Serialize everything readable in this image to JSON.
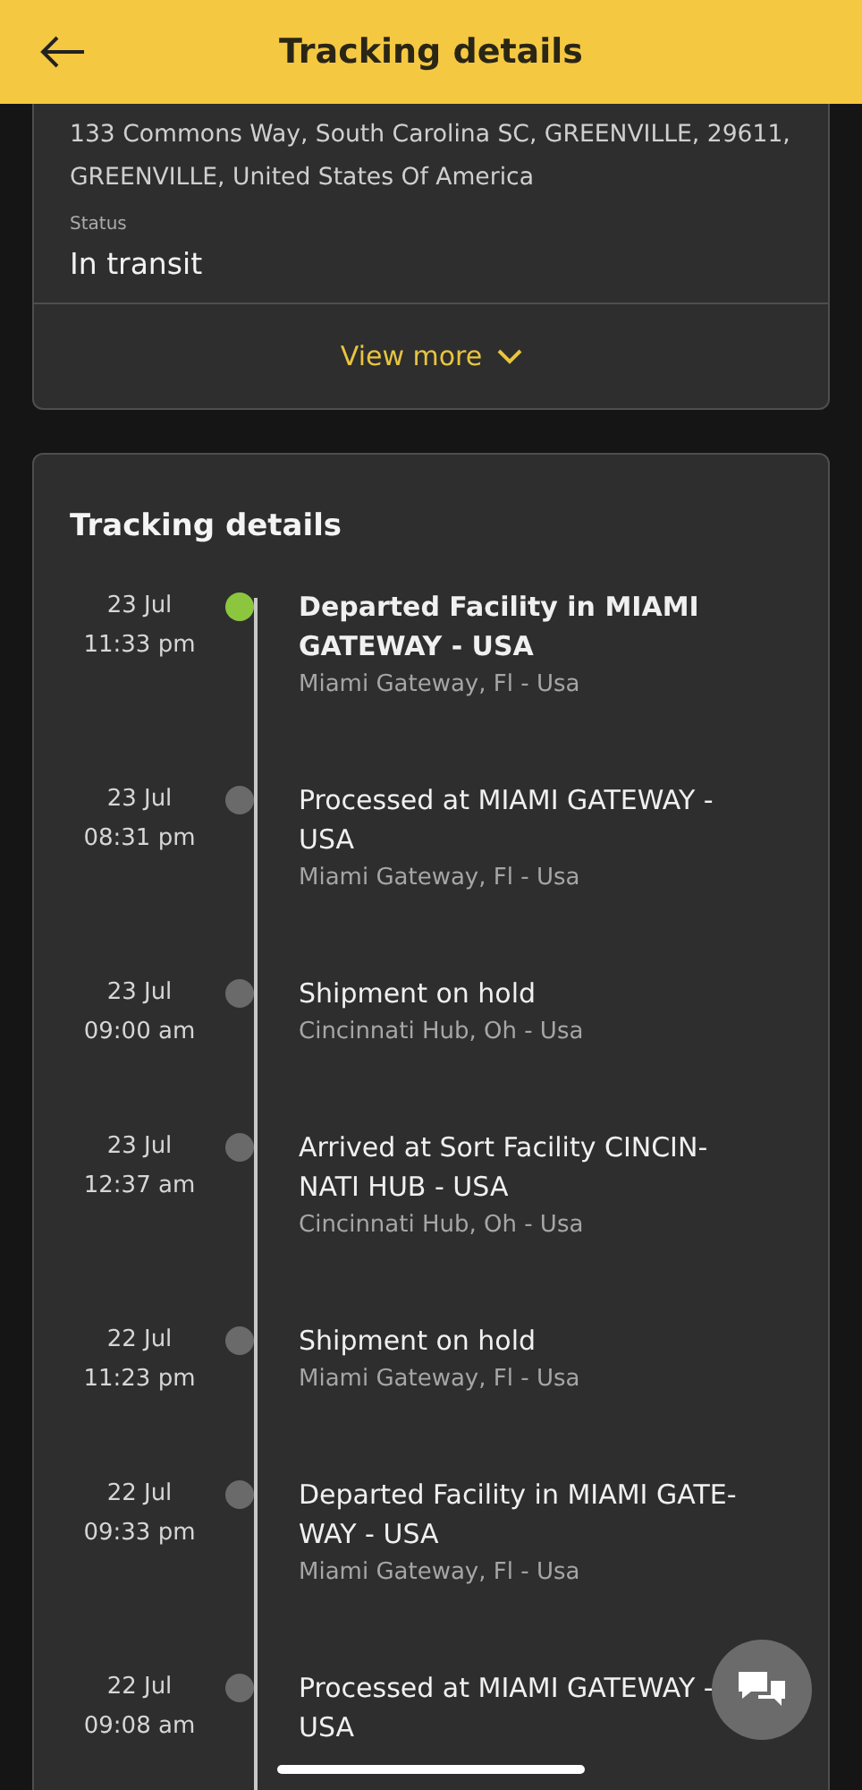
{
  "header": {
    "title": "Tracking details"
  },
  "address_card": {
    "address": "133 Commons Way, South Carolina SC, GREENVILLE, 29611, GREENVILLE, United States Of America",
    "status_label": "Status",
    "status": "In transit",
    "view_more": "View more"
  },
  "tracking": {
    "title": "Tracking details",
    "events": [
      {
        "date": "23 Jul",
        "time": "11:33 pm",
        "title": "Departed Facility in MIAMI GATEWAY - USA",
        "location": "Miami Gateway, Fl - Usa",
        "current": true
      },
      {
        "date": "23 Jul",
        "time": "08:31 pm",
        "title": "Processed at MIAMI GATEWAY - USA",
        "location": "Miami Gateway, Fl - Usa",
        "current": false
      },
      {
        "date": "23 Jul",
        "time": "09:00 am",
        "title": "Shipment on hold",
        "location": "Cincinnati Hub, Oh - Usa",
        "current": false
      },
      {
        "date": "23 Jul",
        "time": "12:37 am",
        "title": "Arrived at Sort Facility CINCIN-NATI HUB - USA",
        "location": "Cincinnati Hub, Oh - Usa",
        "current": false
      },
      {
        "date": "22 Jul",
        "time": "11:23 pm",
        "title": "Shipment on hold",
        "location": "Miami Gateway, Fl - Usa",
        "current": false
      },
      {
        "date": "22 Jul",
        "time": "09:33 pm",
        "title": "Departed Facility in MIAMI GATE-WAY - USA",
        "location": "Miami Gateway, Fl - Usa",
        "current": false
      },
      {
        "date": "22 Jul",
        "time": "09:08 am",
        "title": "Processed at MIAMI GATEWAY - USA",
        "current": false
      }
    ]
  }
}
